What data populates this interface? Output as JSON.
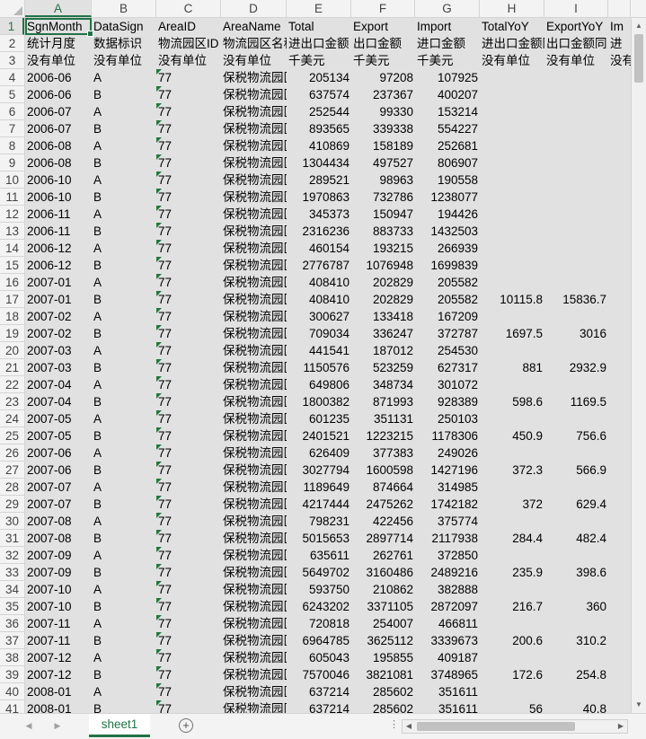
{
  "columns": [
    {
      "letter": "A",
      "width": 74
    },
    {
      "letter": "B",
      "width": 72
    },
    {
      "letter": "C",
      "width": 72
    },
    {
      "letter": "D",
      "width": 73
    },
    {
      "letter": "E",
      "width": 72
    },
    {
      "letter": "F",
      "width": 71
    },
    {
      "letter": "G",
      "width": 72
    },
    {
      "letter": "H",
      "width": 72
    },
    {
      "letter": "I",
      "width": 71
    },
    {
      "letter": "",
      "width": 25
    }
  ],
  "rows": [
    [
      "SgnMonth",
      "DataSign",
      "AreaID",
      "AreaName",
      "Total",
      "Export",
      "Import",
      "TotalYoY",
      "ExportYoY",
      "Im"
    ],
    [
      "统计月度",
      "数据标识",
      "物流园区ID",
      "物流园区名称",
      "进出口金额",
      "出口金额",
      "进口金额",
      "进出口金额同比",
      "出口金额同比",
      "进"
    ],
    [
      "没有单位",
      "没有单位",
      "没有单位",
      "没有单位",
      "千美元",
      "千美元",
      "千美元",
      "没有单位",
      "没有单位",
      "没有"
    ],
    [
      "2006-06",
      "A",
      "77",
      "保税物流园区",
      "205134",
      "97208",
      "107925",
      "",
      "",
      ""
    ],
    [
      "2006-06",
      "B",
      "77",
      "保税物流园区",
      "637574",
      "237367",
      "400207",
      "",
      "",
      ""
    ],
    [
      "2006-07",
      "A",
      "77",
      "保税物流园区",
      "252544",
      "99330",
      "153214",
      "",
      "",
      ""
    ],
    [
      "2006-07",
      "B",
      "77",
      "保税物流园区",
      "893565",
      "339338",
      "554227",
      "",
      "",
      ""
    ],
    [
      "2006-08",
      "A",
      "77",
      "保税物流园区",
      "410869",
      "158189",
      "252681",
      "",
      "",
      ""
    ],
    [
      "2006-08",
      "B",
      "77",
      "保税物流园区",
      "1304434",
      "497527",
      "806907",
      "",
      "",
      ""
    ],
    [
      "2006-10",
      "A",
      "77",
      "保税物流园区",
      "289521",
      "98963",
      "190558",
      "",
      "",
      ""
    ],
    [
      "2006-10",
      "B",
      "77",
      "保税物流园区",
      "1970863",
      "732786",
      "1238077",
      "",
      "",
      ""
    ],
    [
      "2006-11",
      "A",
      "77",
      "保税物流园区",
      "345373",
      "150947",
      "194426",
      "",
      "",
      ""
    ],
    [
      "2006-11",
      "B",
      "77",
      "保税物流园区",
      "2316236",
      "883733",
      "1432503",
      "",
      "",
      ""
    ],
    [
      "2006-12",
      "A",
      "77",
      "保税物流园区",
      "460154",
      "193215",
      "266939",
      "",
      "",
      ""
    ],
    [
      "2006-12",
      "B",
      "77",
      "保税物流园区",
      "2776787",
      "1076948",
      "1699839",
      "",
      "",
      ""
    ],
    [
      "2007-01",
      "A",
      "77",
      "保税物流园区",
      "408410",
      "202829",
      "205582",
      "",
      "",
      ""
    ],
    [
      "2007-01",
      "B",
      "77",
      "保税物流园区",
      "408410",
      "202829",
      "205582",
      "10115.8",
      "15836.7",
      ""
    ],
    [
      "2007-02",
      "A",
      "77",
      "保税物流园区",
      "300627",
      "133418",
      "167209",
      "",
      "",
      ""
    ],
    [
      "2007-02",
      "B",
      "77",
      "保税物流园区",
      "709034",
      "336247",
      "372787",
      "1697.5",
      "3016",
      ""
    ],
    [
      "2007-03",
      "A",
      "77",
      "保税物流园区",
      "441541",
      "187012",
      "254530",
      "",
      "",
      ""
    ],
    [
      "2007-03",
      "B",
      "77",
      "保税物流园区",
      "1150576",
      "523259",
      "627317",
      "881",
      "2932.9",
      ""
    ],
    [
      "2007-04",
      "A",
      "77",
      "保税物流园区",
      "649806",
      "348734",
      "301072",
      "",
      "",
      ""
    ],
    [
      "2007-04",
      "B",
      "77",
      "保税物流园区",
      "1800382",
      "871993",
      "928389",
      "598.6",
      "1169.5",
      ""
    ],
    [
      "2007-05",
      "A",
      "77",
      "保税物流园区",
      "601235",
      "351131",
      "250103",
      "",
      "",
      ""
    ],
    [
      "2007-05",
      "B",
      "77",
      "保税物流园区",
      "2401521",
      "1223215",
      "1178306",
      "450.9",
      "756.6",
      ""
    ],
    [
      "2007-06",
      "A",
      "77",
      "保税物流园区",
      "626409",
      "377383",
      "249026",
      "",
      "",
      ""
    ],
    [
      "2007-06",
      "B",
      "77",
      "保税物流园区",
      "3027794",
      "1600598",
      "1427196",
      "372.3",
      "566.9",
      ""
    ],
    [
      "2007-07",
      "A",
      "77",
      "保税物流园区",
      "1189649",
      "874664",
      "314985",
      "",
      "",
      ""
    ],
    [
      "2007-07",
      "B",
      "77",
      "保税物流园区",
      "4217444",
      "2475262",
      "1742182",
      "372",
      "629.4",
      ""
    ],
    [
      "2007-08",
      "A",
      "77",
      "保税物流园区",
      "798231",
      "422456",
      "375774",
      "",
      "",
      ""
    ],
    [
      "2007-08",
      "B",
      "77",
      "保税物流园区",
      "5015653",
      "2897714",
      "2117938",
      "284.4",
      "482.4",
      ""
    ],
    [
      "2007-09",
      "A",
      "77",
      "保税物流园区",
      "635611",
      "262761",
      "372850",
      "",
      "",
      ""
    ],
    [
      "2007-09",
      "B",
      "77",
      "保税物流园区",
      "5649702",
      "3160486",
      "2489216",
      "235.9",
      "398.6",
      ""
    ],
    [
      "2007-10",
      "A",
      "77",
      "保税物流园区",
      "593750",
      "210862",
      "382888",
      "",
      "",
      ""
    ],
    [
      "2007-10",
      "B",
      "77",
      "保税物流园区",
      "6243202",
      "3371105",
      "2872097",
      "216.7",
      "360",
      ""
    ],
    [
      "2007-11",
      "A",
      "77",
      "保税物流园区",
      "720818",
      "254007",
      "466811",
      "",
      "",
      ""
    ],
    [
      "2007-11",
      "B",
      "77",
      "保税物流园区",
      "6964785",
      "3625112",
      "3339673",
      "200.6",
      "310.2",
      ""
    ],
    [
      "2007-12",
      "A",
      "77",
      "保税物流园区",
      "605043",
      "195855",
      "409187",
      "",
      "",
      ""
    ],
    [
      "2007-12",
      "B",
      "77",
      "保税物流园区",
      "7570046",
      "3821081",
      "3748965",
      "172.6",
      "254.8",
      ""
    ],
    [
      "2008-01",
      "A",
      "77",
      "保税物流园区",
      "637214",
      "285602",
      "351611",
      "",
      "",
      ""
    ],
    [
      "2008-01",
      "B",
      "77",
      "保税物流园区",
      "637214",
      "285602",
      "351611",
      "56",
      "40.8",
      ""
    ]
  ],
  "sheet_tab": "sheet1",
  "add_sheet_label": "+",
  "tab_dots": "⋮",
  "icons": {
    "scroll_up": "▲",
    "scroll_down": "▼",
    "scroll_left": "◀",
    "scroll_right": "▶",
    "prev_sheet": "◀",
    "next_sheet": "▶"
  },
  "colors": {
    "accent": "#217346",
    "header_bg": "#f3f3f3",
    "gridline": "#e1e1e1"
  }
}
